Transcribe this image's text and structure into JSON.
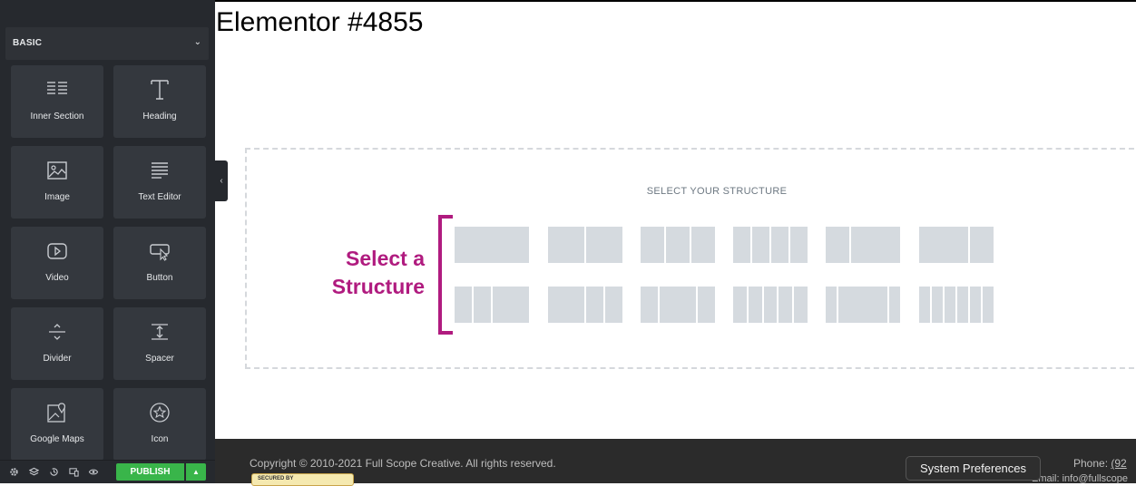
{
  "colors": {
    "accent": "#b01b7f",
    "publish": "#39b54a",
    "sidebar": "#26292e"
  },
  "sidebar": {
    "category": "BASIC",
    "widgets": [
      {
        "label": "Inner Section",
        "icon": "inner-section-icon"
      },
      {
        "label": "Heading",
        "icon": "heading-icon"
      },
      {
        "label": "Image",
        "icon": "image-icon"
      },
      {
        "label": "Text Editor",
        "icon": "text-editor-icon"
      },
      {
        "label": "Video",
        "icon": "video-icon"
      },
      {
        "label": "Button",
        "icon": "button-icon"
      },
      {
        "label": "Divider",
        "icon": "divider-icon"
      },
      {
        "label": "Spacer",
        "icon": "spacer-icon"
      },
      {
        "label": "Google Maps",
        "icon": "google-maps-icon"
      },
      {
        "label": "Icon",
        "icon": "star-icon"
      }
    ],
    "footer": {
      "publish_label": "PUBLISH"
    }
  },
  "canvas": {
    "page_title": "Elementor #4855",
    "structure_heading": "SELECT YOUR STRUCTURE",
    "annotation": {
      "line1": "Select a",
      "line2": "Structure"
    }
  },
  "site_footer": {
    "copyright": "Copyright © 2010-2021 Full Scope Creative. All rights reserved.",
    "secured_badge": "SECURED BY",
    "phone_label": "Phone:",
    "phone_value": "(92",
    "email": "Email: info@fullscope"
  },
  "tooltip": "System Preferences"
}
